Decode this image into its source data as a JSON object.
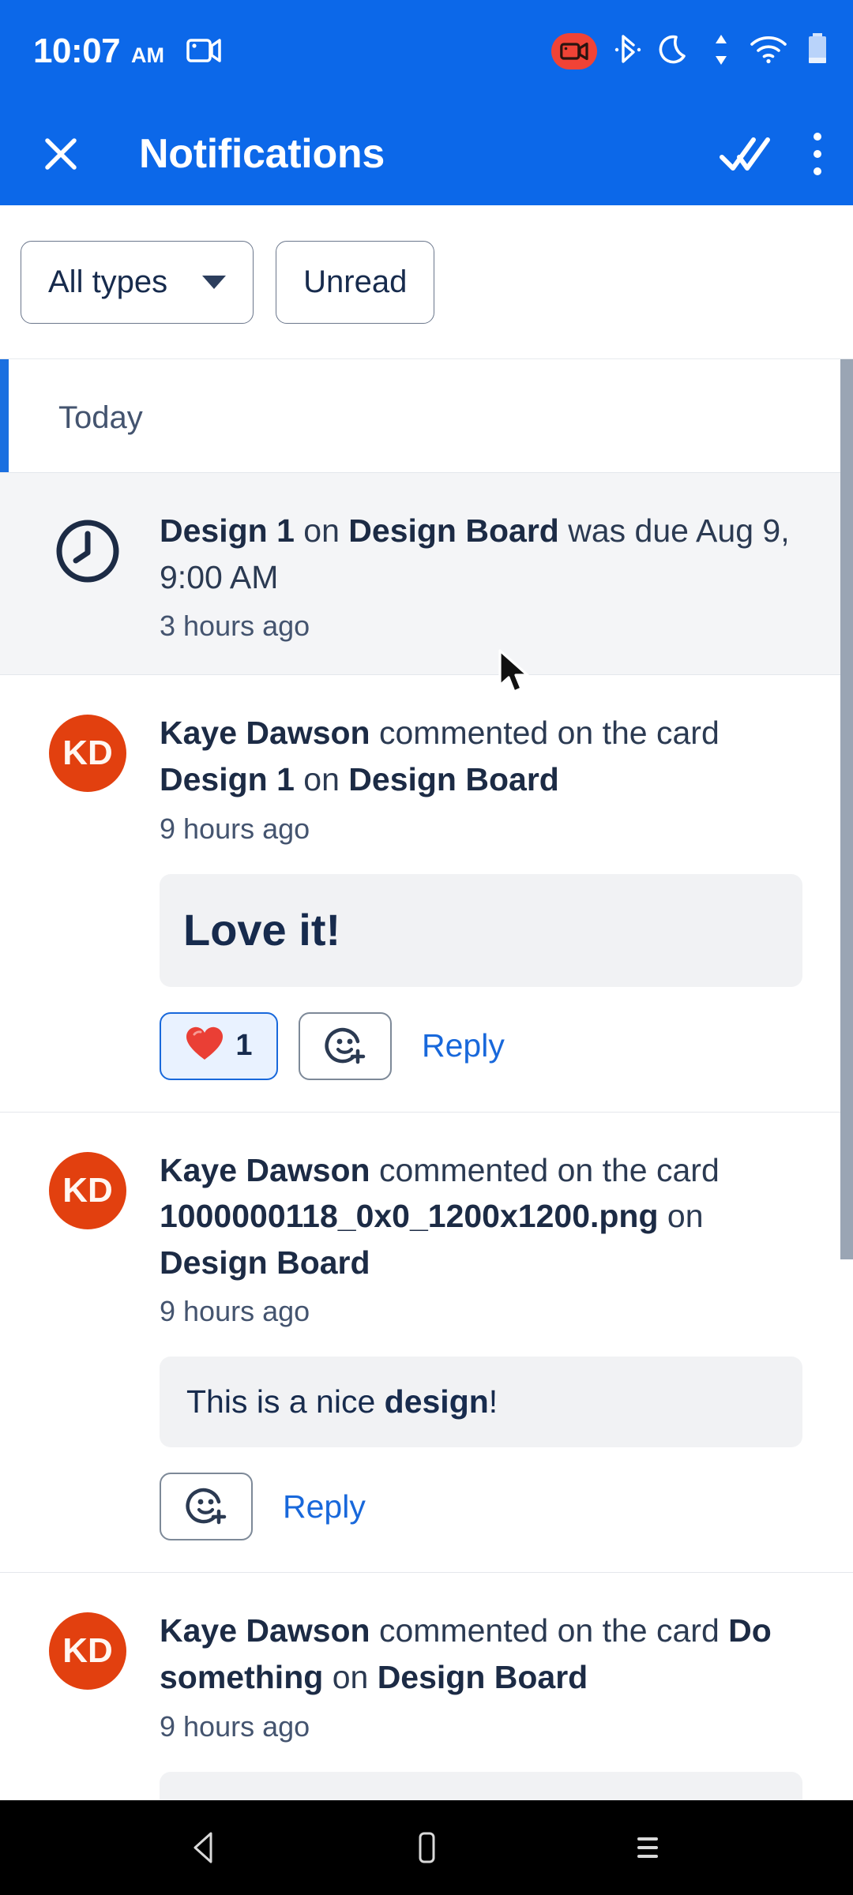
{
  "status_bar": {
    "time": "10:07",
    "ampm": "AM",
    "icons": [
      "cast-screen-icon",
      "screen-record-icon",
      "bluetooth-icon",
      "do-not-disturb-moon-icon",
      "data-transfer-icon",
      "wifi-icon",
      "battery-icon"
    ]
  },
  "app_bar": {
    "close_label": "close-icon",
    "title": "Notifications",
    "mark_all_read_label": "double-check-icon",
    "overflow_label": "more-vertical-icon"
  },
  "filters": {
    "type_chip": "All types",
    "unread_chip": "Unread"
  },
  "sections": [
    {
      "label": "Today"
    }
  ],
  "notifications": [
    {
      "id": "due-date",
      "unread": true,
      "icon": "clock-icon",
      "text_parts": [
        {
          "t": "Design 1",
          "b": true
        },
        {
          "t": " on ",
          "b": false
        },
        {
          "t": "Design Board",
          "b": true
        },
        {
          "t": " was due Aug 9, 9:00 AM",
          "b": false
        }
      ],
      "time": "3 hours ago"
    },
    {
      "id": "comment-design1",
      "unread": false,
      "avatar": "KD",
      "text_parts": [
        {
          "t": "Kaye Dawson",
          "b": true
        },
        {
          "t": " commented on the card ",
          "b": false
        },
        {
          "t": "Design 1",
          "b": true
        },
        {
          "t": " on ",
          "b": false
        },
        {
          "t": "Design Board",
          "b": true
        }
      ],
      "time": "9 hours ago",
      "comment_style": "heading",
      "comment_parts": [
        {
          "t": "Love it!",
          "b": false
        }
      ],
      "reaction": {
        "emoji": "heart-emoji",
        "count": "1",
        "selected": true
      },
      "add_reaction": "add-reaction-icon",
      "reply": "Reply"
    },
    {
      "id": "comment-png",
      "unread": false,
      "avatar": "KD",
      "text_parts": [
        {
          "t": "Kaye Dawson",
          "b": true
        },
        {
          "t": " commented on the card ",
          "b": false
        },
        {
          "t": "1000000118_0x0_1200x1200.png",
          "b": true
        },
        {
          "t": " on ",
          "b": false
        },
        {
          "t": "Design Board",
          "b": true
        }
      ],
      "time": "9 hours ago",
      "comment_style": "normal",
      "comment_parts": [
        {
          "t": "This is a nice ",
          "b": false
        },
        {
          "t": "design",
          "b": true
        },
        {
          "t": "!",
          "b": false
        }
      ],
      "add_reaction": "add-reaction-icon",
      "reply": "Reply"
    },
    {
      "id": "comment-dosomething",
      "unread": false,
      "avatar": "KD",
      "text_parts": [
        {
          "t": "Kaye Dawson",
          "b": true
        },
        {
          "t": " commented on the card ",
          "b": false
        },
        {
          "t": "Do something",
          "b": true
        },
        {
          "t": " on ",
          "b": false
        },
        {
          "t": "Design Board",
          "b": true
        }
      ],
      "time": "9 hours ago",
      "comment_style": "empty",
      "comment_parts": []
    }
  ],
  "nav_bar": {
    "back": "back-triangle-icon",
    "home": "home-square-icon",
    "recents": "recents-menu-icon"
  },
  "colors": {
    "brand_blue": "#0c68e9",
    "link_blue": "#1868db",
    "avatar_red": "#e2400f",
    "unread_bg": "#f4f5f7",
    "record_red": "#f04336"
  }
}
